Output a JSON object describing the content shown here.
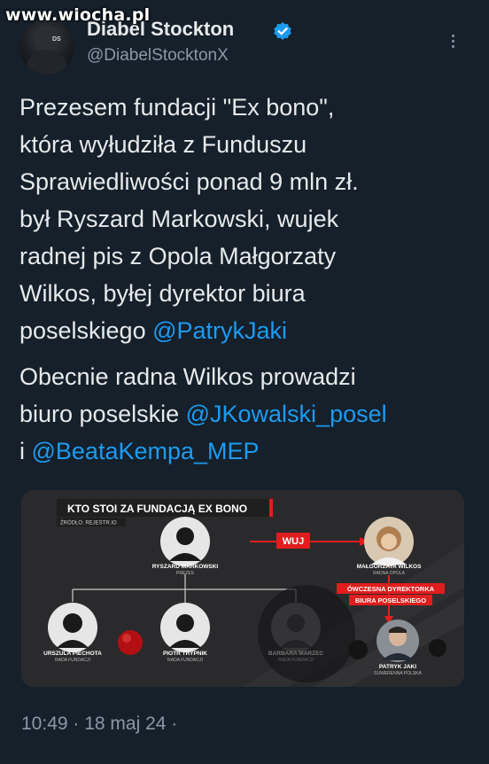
{
  "watermark": "www.wiocha.pl",
  "author": {
    "name": "Diabel Stockton",
    "handle": "@DiabelStocktonX",
    "avatar_text": "DS"
  },
  "tweet": {
    "paragraph1_lines": [
      "Prezesem fundacji \"Ex bono\",",
      "która wyłudziła z Funduszu",
      "Sprawiedliwości ponad 9 mln zł.",
      "był Ryszard Markowski, wujek",
      "radnej pis z Opola Małgorzaty",
      "Wilkos, byłej dyrektor biura"
    ],
    "paragraph1_last_prefix": "poselskiego ",
    "mention1": "@PatrykJaki",
    "paragraph2_line1": "Obecnie radna Wilkos prowadzi",
    "paragraph2_line2_prefix": "biuro poselskie ",
    "mention2": "@JKowalski_posel",
    "paragraph2_line3_prefix": "i ",
    "mention3": "@BeataKempa_MEP"
  },
  "graphic": {
    "title": "KTO STOI ZA FUNDACJĄ EX BONO",
    "source": "ŹRÓDŁO: REJESTR.IO",
    "relation_uncle": "WUJ",
    "relation_director_line1": "ÓWCZESNA DYREKTORKA",
    "relation_director_line2": "BIURA POSELSKIEGO",
    "people": [
      {
        "name": "RYSZARD MARKOWSKI",
        "role": "PREZES"
      },
      {
        "name": "MAŁGORZATA WILKOS",
        "role": "RADNA OPOLA"
      },
      {
        "name": "URSZULA PIECHOTA",
        "role": "RADA FUNDACJI"
      },
      {
        "name": "PIOTR TRYPNIK",
        "role": "RADA FUNDACJI"
      },
      {
        "name": "BARBARA MARZEC",
        "role": "RADA FUNDACJI"
      },
      {
        "name": "PATRYK JAKI",
        "role": "SUWERENNA POLSKA"
      }
    ],
    "accent_red": "#e11d1d"
  },
  "timestamp": "10:49 · 18 maj 24 ·",
  "colors": {
    "background": "#15202b",
    "link": "#1d9bf0",
    "verified": "#1d9bf0",
    "secondary": "#8b98a5"
  }
}
